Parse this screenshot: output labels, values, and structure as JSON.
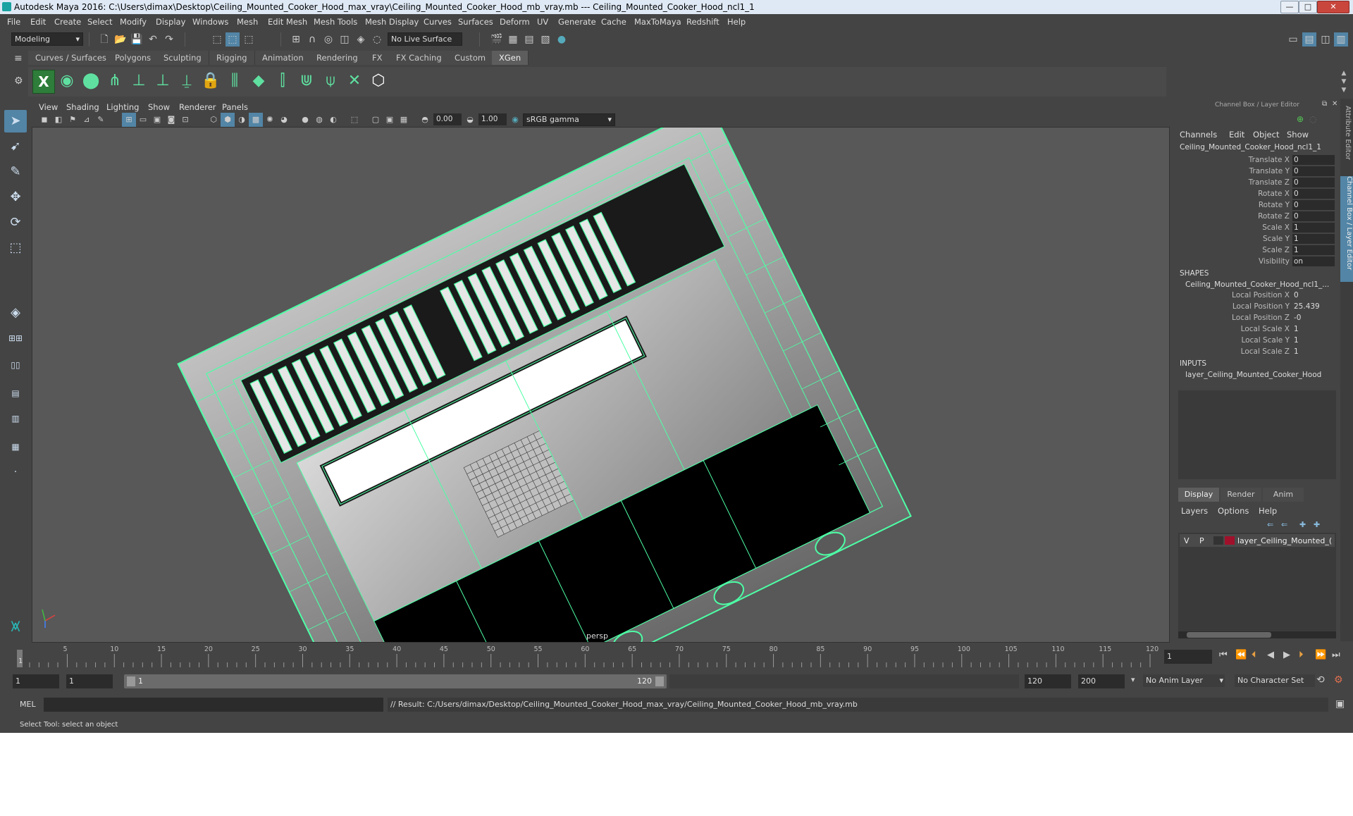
{
  "window": {
    "title": "Autodesk Maya 2016: C:\\Users\\dimax\\Desktop\\Ceiling_Mounted_Cooker_Hood_max_vray\\Ceiling_Mounted_Cooker_Hood_mb_vray.mb   ---   Ceiling_Mounted_Cooker_Hood_ncl1_1",
    "minimize": "—",
    "maximize": "□",
    "close": "✕"
  },
  "menubar": [
    "File",
    "Edit",
    "Create",
    "Select",
    "Modify",
    "Display",
    "Windows",
    "Mesh",
    "Edit Mesh",
    "Mesh Tools",
    "Mesh Display",
    "Curves",
    "Surfaces",
    "Deform",
    "UV",
    "Generate",
    "Cache",
    "MaxToMaya",
    "Redshift",
    "Help"
  ],
  "statusline": {
    "mode": "Modeling",
    "live_surface": "No Live Surface"
  },
  "shelf": {
    "tabs": [
      "Curves / Surfaces",
      "Polygons",
      "Sculpting",
      "Rigging",
      "Animation",
      "Rendering",
      "FX",
      "FX Caching",
      "Custom",
      "XGen"
    ],
    "active_tab": "XGen"
  },
  "viewport": {
    "menu": [
      "View",
      "Shading",
      "Lighting",
      "Show",
      "Renderer",
      "Panels"
    ],
    "exposure": "0.00",
    "gamma": "1.00",
    "color_space": "sRGB gamma",
    "camera_label": "persp"
  },
  "channel_box": {
    "header": "Channel Box / Layer Editor",
    "menu": [
      "Channels",
      "Edit",
      "Object",
      "Show"
    ],
    "object_name": "Ceiling_Mounted_Cooker_Hood_ncl1_1",
    "attributes": [
      {
        "label": "Translate X",
        "value": "0"
      },
      {
        "label": "Translate Y",
        "value": "0"
      },
      {
        "label": "Translate Z",
        "value": "0"
      },
      {
        "label": "Rotate X",
        "value": "0"
      },
      {
        "label": "Rotate Y",
        "value": "0"
      },
      {
        "label": "Rotate Z",
        "value": "0"
      },
      {
        "label": "Scale X",
        "value": "1"
      },
      {
        "label": "Scale Y",
        "value": "1"
      },
      {
        "label": "Scale Z",
        "value": "1"
      },
      {
        "label": "Visibility",
        "value": "on"
      }
    ],
    "shapes_header": "SHAPES",
    "shape_name": "Ceiling_Mounted_Cooker_Hood_ncl1_...",
    "shape_attributes": [
      {
        "label": "Local Position X",
        "value": "0"
      },
      {
        "label": "Local Position Y",
        "value": "25.439"
      },
      {
        "label": "Local Position Z",
        "value": "-0"
      },
      {
        "label": "Local Scale X",
        "value": "1"
      },
      {
        "label": "Local Scale Y",
        "value": "1"
      },
      {
        "label": "Local Scale Z",
        "value": "1"
      }
    ],
    "inputs_header": "INPUTS",
    "input_name": "layer_Ceiling_Mounted_Cooker_Hood"
  },
  "layer_editor": {
    "tabs": [
      "Display",
      "Render",
      "Anim"
    ],
    "active_tab": "Display",
    "menu": [
      "Layers",
      "Options",
      "Help"
    ],
    "layer": {
      "v": "V",
      "p": "P",
      "name": "layer_Ceiling_Mounted_(",
      "color": "#a0102a"
    }
  },
  "side_tabs": [
    "Attribute Editor",
    "Channel Box / Layer Editor"
  ],
  "timeline": {
    "ticks": [
      "5",
      "10",
      "15",
      "20",
      "25",
      "30",
      "35",
      "40",
      "45",
      "50",
      "55",
      "60",
      "65",
      "70",
      "75",
      "80",
      "85",
      "90",
      "95",
      "100",
      "105",
      "110",
      "115",
      "120"
    ],
    "start_label": "1",
    "current_frame": "1"
  },
  "range": {
    "start": "1",
    "playback_start": "1",
    "slider_start": "1",
    "slider_end": "120",
    "playback_end": "120",
    "end": "200",
    "anim_layer": "No Anim Layer",
    "character_set": "No Character Set"
  },
  "cmdline": {
    "lang": "MEL",
    "result": "// Result: C:/Users/dimax/Desktop/Ceiling_Mounted_Cooker_Hood_max_vray/Ceiling_Mounted_Cooker_Hood_mb_vray.mb"
  },
  "helpline": {
    "text": "Select Tool: select an object"
  },
  "colors": {
    "accent": "#5285a6",
    "wire": "#4dffa6"
  }
}
